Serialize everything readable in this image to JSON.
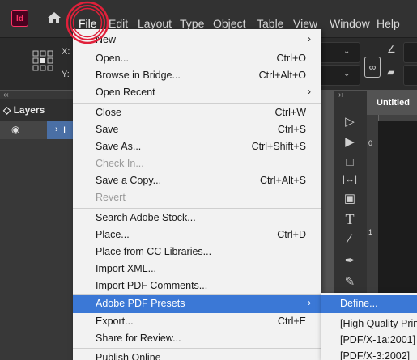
{
  "menubar": {
    "app_icon": "Id",
    "items": [
      "File",
      "Edit",
      "Layout",
      "Type",
      "Object",
      "Table",
      "View",
      "Window",
      "Help"
    ]
  },
  "controlbar": {
    "x_label": "X:",
    "y_label": "Y:"
  },
  "layers_panel": {
    "title": "Layers",
    "layer_name": "L"
  },
  "document": {
    "tab_title": "Untitled",
    "ruler_marks": [
      "0",
      "1"
    ]
  },
  "file_menu": {
    "items": [
      {
        "label": "New",
        "shortcut": "",
        "submenu": true
      },
      {
        "label": "Open...",
        "shortcut": "Ctrl+O"
      },
      {
        "label": "Browse in Bridge...",
        "shortcut": "Ctrl+Alt+O"
      },
      {
        "label": "Open Recent",
        "shortcut": "",
        "submenu": true
      },
      {
        "label": "Close",
        "shortcut": "Ctrl+W"
      },
      {
        "label": "Save",
        "shortcut": "Ctrl+S"
      },
      {
        "label": "Save As...",
        "shortcut": "Ctrl+Shift+S"
      },
      {
        "label": "Check In...",
        "shortcut": "",
        "disabled": true
      },
      {
        "label": "Save a Copy...",
        "shortcut": "Ctrl+Alt+S"
      },
      {
        "label": "Revert",
        "shortcut": "",
        "disabled": true
      },
      {
        "label": "Search Adobe Stock...",
        "shortcut": ""
      },
      {
        "label": "Place...",
        "shortcut": "Ctrl+D"
      },
      {
        "label": "Place from CC Libraries...",
        "shortcut": ""
      },
      {
        "label": "Import XML...",
        "shortcut": ""
      },
      {
        "label": "Import PDF Comments...",
        "shortcut": ""
      },
      {
        "label": "Adobe PDF Presets",
        "shortcut": "",
        "submenu": true,
        "active": true
      },
      {
        "label": "Export...",
        "shortcut": "Ctrl+E"
      },
      {
        "label": "Share for Review...",
        "shortcut": ""
      },
      {
        "label": "Publish Online",
        "shortcut": ""
      }
    ]
  },
  "pdf_presets_submenu": {
    "items": [
      "Define...",
      "[High Quality Print]",
      "[PDF/X-1a:2001]",
      "[PDF/X-3:2002]"
    ]
  },
  "colors": {
    "menu_highlight": "#3b78d6",
    "annotation_circle": "#e0203a"
  }
}
